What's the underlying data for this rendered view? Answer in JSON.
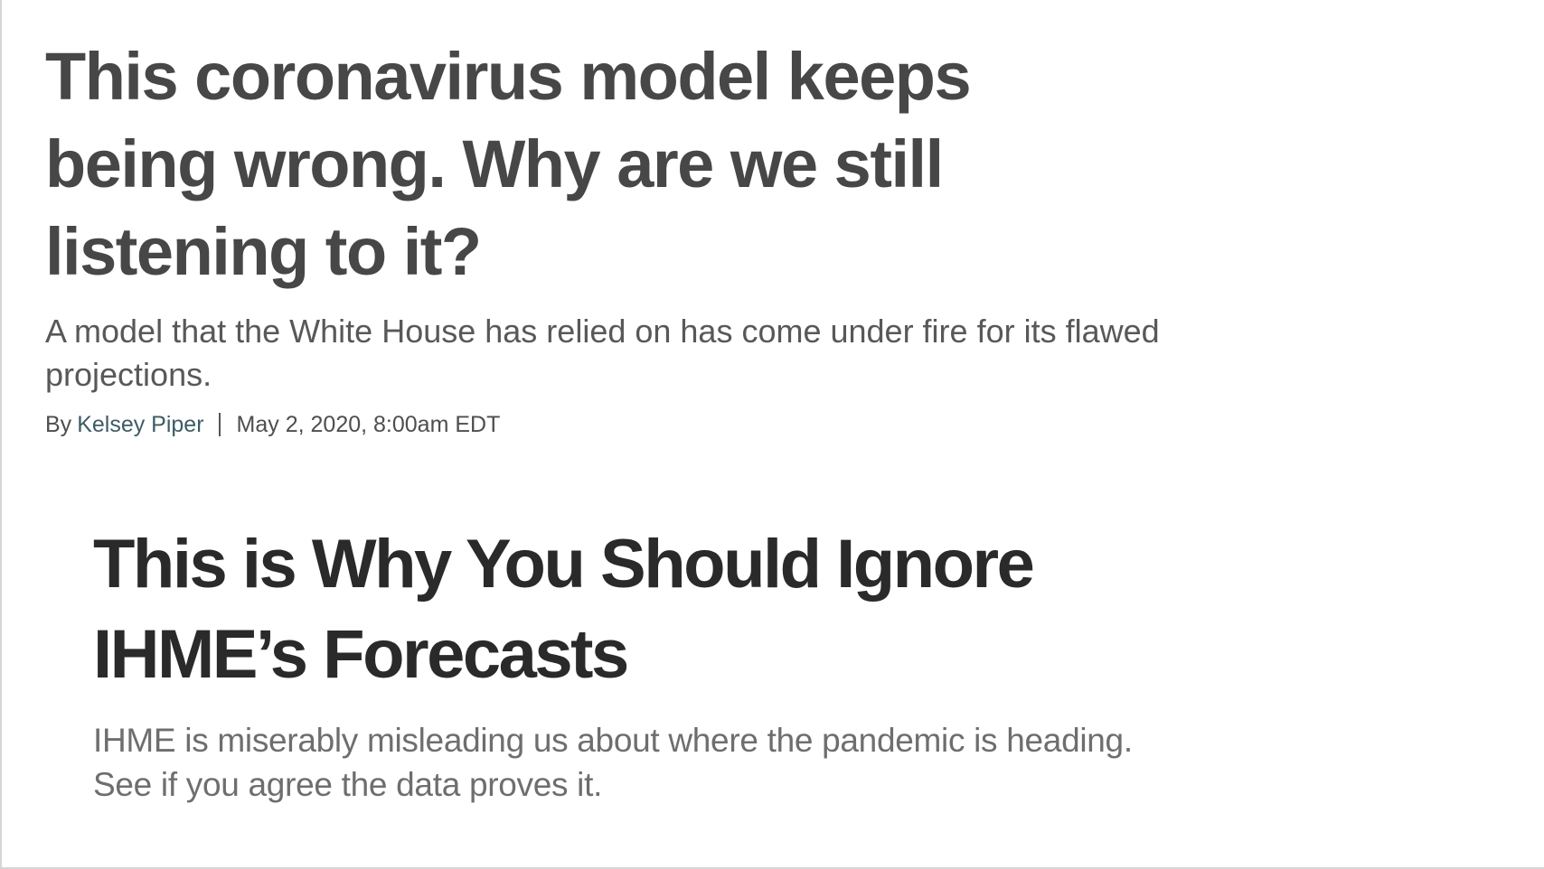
{
  "article_one": {
    "headline": "This coronavirus model keeps being wrong. Why are we still listening to it?",
    "dek": "A model that the White House has relied on has come under fire for its flawed projections.",
    "byline_prefix": "By",
    "author": "Kelsey Piper",
    "separator": "|",
    "date": "May 2, 2020, 8:00am EDT",
    "colors": {
      "headline": "#474747",
      "author_link": "#3e5b66"
    }
  },
  "article_two": {
    "headline": "This is Why You Should Ignore IHME’s Forecasts",
    "dek": "IHME is miserably misleading us about where the pandemic is heading. See if you agree the data proves it.",
    "colors": {
      "headline": "#2a2a2a",
      "dek": "#6e6e6e"
    }
  }
}
